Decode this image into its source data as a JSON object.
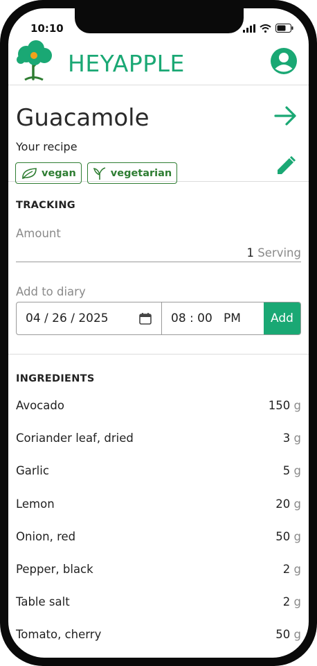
{
  "status": {
    "time": "10:10"
  },
  "brand": {
    "bold": "HEY",
    "light": "APPLE",
    "accent": "#1aa874"
  },
  "recipe": {
    "title": "Guacamole",
    "subtitle": "Your recipe",
    "tags": [
      {
        "label": "vegan",
        "icon": "leaf-icon"
      },
      {
        "label": "vegetarian",
        "icon": "sprout-icon"
      }
    ]
  },
  "tracking": {
    "title": "TRACKING",
    "amount_label": "Amount",
    "amount_value": "1",
    "amount_unit": "Serving",
    "diary_label": "Add to diary",
    "date": "04 / 26 / 2025",
    "time": "08 : 00   PM",
    "add_label": "Add"
  },
  "ingredients": {
    "title": "INGREDIENTS",
    "items": [
      {
        "name": "Avocado",
        "qty": "150",
        "unit": "g"
      },
      {
        "name": "Coriander leaf, dried",
        "qty": "3",
        "unit": "g"
      },
      {
        "name": "Garlic",
        "qty": "5",
        "unit": "g"
      },
      {
        "name": "Lemon",
        "qty": "20",
        "unit": "g"
      },
      {
        "name": "Onion, red",
        "qty": "50",
        "unit": "g"
      },
      {
        "name": "Pepper, black",
        "qty": "2",
        "unit": "g"
      },
      {
        "name": "Table salt",
        "qty": "2",
        "unit": "g"
      },
      {
        "name": "Tomato, cherry",
        "qty": "50",
        "unit": "g"
      }
    ]
  }
}
